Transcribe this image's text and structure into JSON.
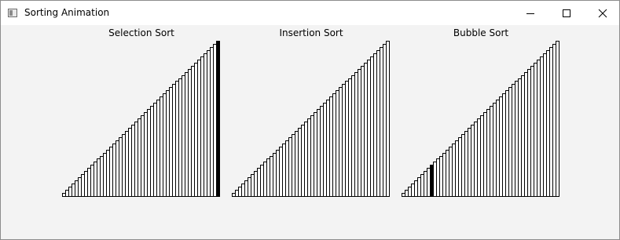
{
  "window": {
    "title": "Sorting Animation",
    "controls": {
      "minimize_icon": "minimize-icon",
      "maximize_icon": "maximize-icon",
      "close_icon": "close-icon"
    }
  },
  "panels": [
    {
      "title": "Selection Sort",
      "highlight_index": 49
    },
    {
      "title": "Insertion Sort",
      "highlight_index": -1
    },
    {
      "title": "Bubble Sort",
      "highlight_index": 9
    }
  ],
  "chart_data": [
    {
      "type": "bar",
      "title": "Selection Sort",
      "values": [
        1,
        2,
        3,
        4,
        5,
        6,
        7,
        8,
        9,
        10,
        11,
        12,
        13,
        14,
        15,
        16,
        17,
        18,
        19,
        20,
        21,
        22,
        23,
        24,
        25,
        26,
        27,
        28,
        29,
        30,
        31,
        32,
        33,
        34,
        35,
        36,
        37,
        38,
        39,
        40,
        41,
        42,
        43,
        44,
        45,
        46,
        47,
        48,
        49,
        50
      ],
      "highlight_index": 49
    },
    {
      "type": "bar",
      "title": "Insertion Sort",
      "values": [
        1,
        2,
        3,
        4,
        5,
        6,
        7,
        8,
        9,
        10,
        11,
        12,
        13,
        14,
        15,
        16,
        17,
        18,
        19,
        20,
        21,
        22,
        23,
        24,
        25,
        26,
        27,
        28,
        29,
        30,
        31,
        32,
        33,
        34,
        35,
        36,
        37,
        38,
        39,
        40,
        41,
        42,
        43,
        44,
        45,
        46,
        47,
        48,
        49,
        50
      ],
      "highlight_index": -1
    },
    {
      "type": "bar",
      "title": "Bubble Sort",
      "values": [
        1,
        2,
        3,
        4,
        5,
        6,
        7,
        8,
        9,
        10,
        11,
        12,
        13,
        14,
        15,
        16,
        17,
        18,
        19,
        20,
        21,
        22,
        23,
        24,
        25,
        26,
        27,
        28,
        29,
        30,
        31,
        32,
        33,
        34,
        35,
        36,
        37,
        38,
        39,
        40,
        41,
        42,
        43,
        44,
        45,
        46,
        47,
        48,
        49,
        50
      ],
      "highlight_index": 9
    }
  ]
}
